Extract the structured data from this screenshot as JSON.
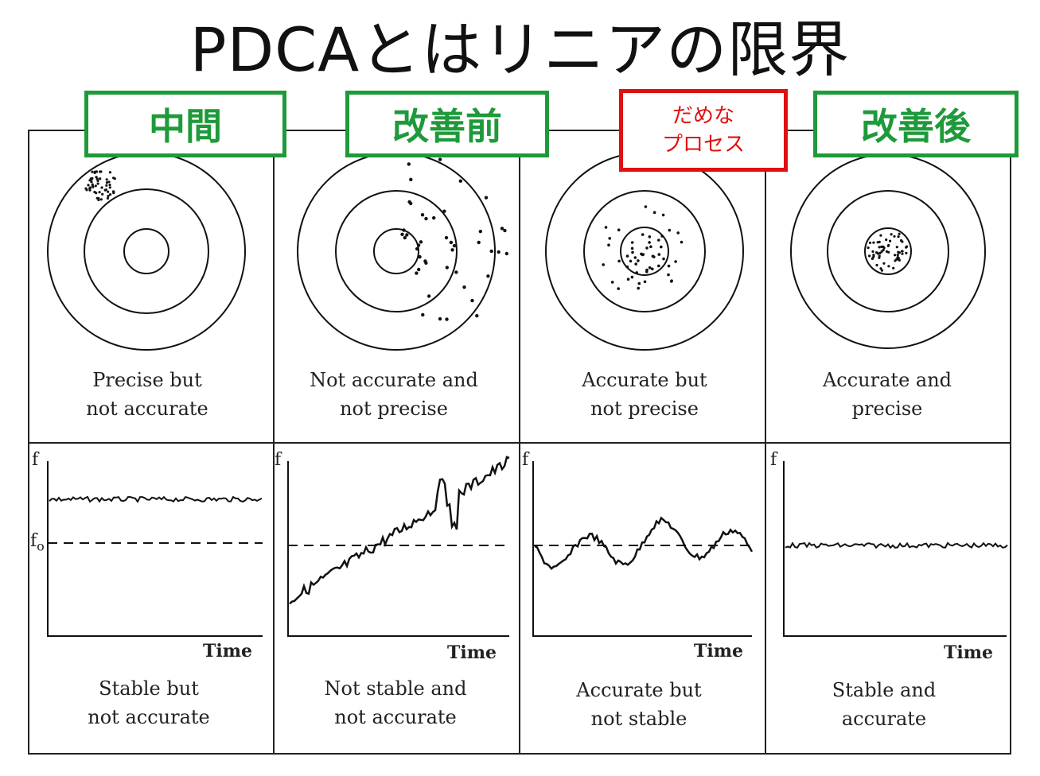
{
  "title": "PDCAとはリニアの限界",
  "tags": [
    {
      "label": "中間"
    },
    {
      "label": "改善前"
    },
    {
      "line1": "だめな",
      "line2": "プロセス"
    },
    {
      "label": "改善後"
    }
  ],
  "targets": [
    {
      "caption1": "Precise but",
      "caption2": "not accurate"
    },
    {
      "caption1": "Not accurate and",
      "caption2": "not precise"
    },
    {
      "caption1": "Accurate but",
      "caption2": "not precise"
    },
    {
      "caption1": "Accurate and",
      "caption2": "precise"
    }
  ],
  "charts": [
    {
      "caption1": "Stable but",
      "caption2": "not accurate"
    },
    {
      "caption1": "Not stable and",
      "caption2": "not accurate"
    },
    {
      "caption1": "Accurate but",
      "caption2": "not stable"
    },
    {
      "caption1": "Stable and",
      "caption2": "accurate"
    }
  ],
  "axis": {
    "y_label": "f",
    "ref_label": "f",
    "ref_sub": "o",
    "x_label": "Time"
  },
  "colors": {
    "good": "#1e9a3a",
    "bad": "#e01010",
    "ink": "#111111"
  }
}
